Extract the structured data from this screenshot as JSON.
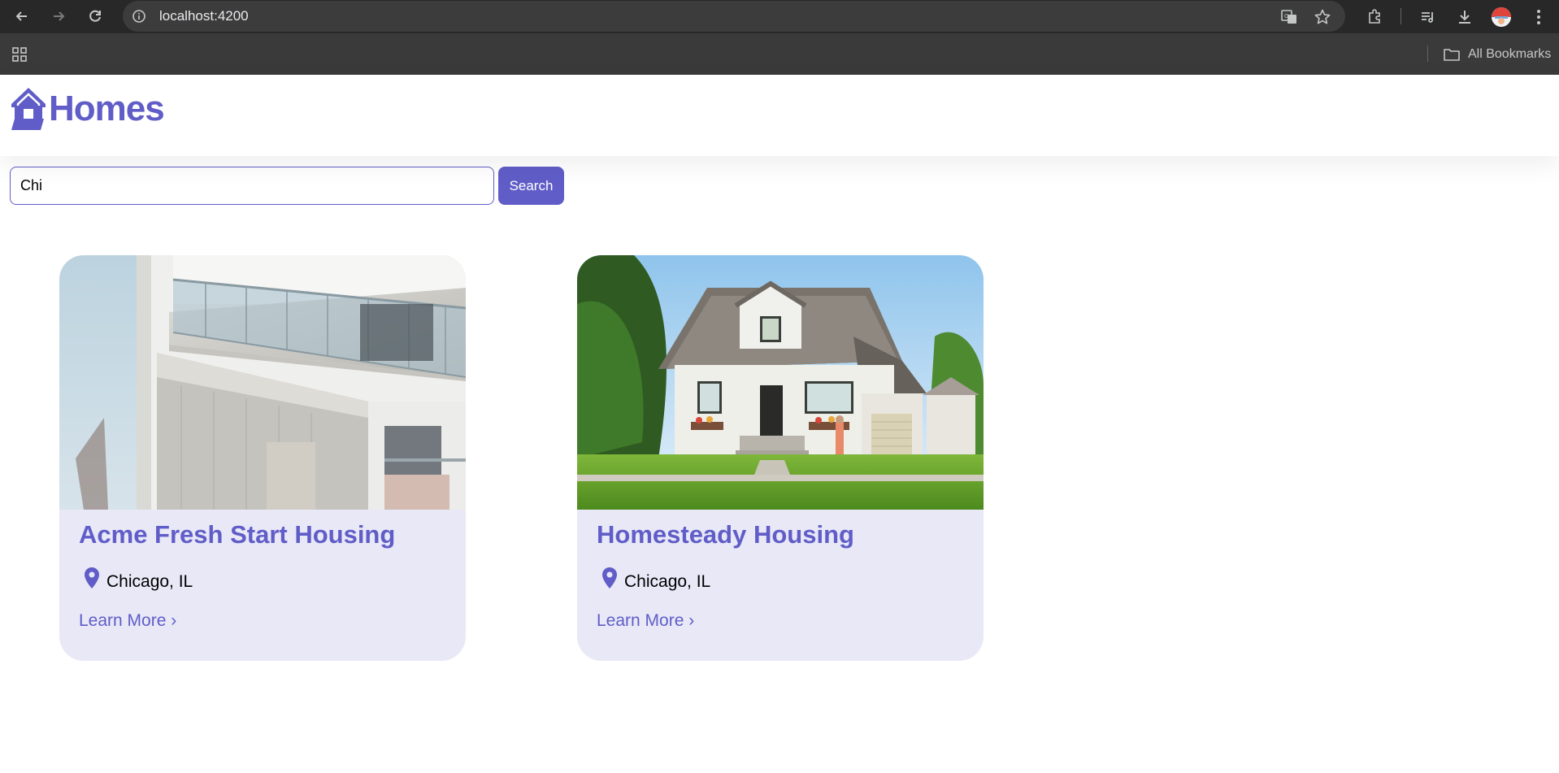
{
  "browser": {
    "url": "localhost:4200",
    "bookmarks_label": "All Bookmarks"
  },
  "header": {
    "logo_text": "Homes"
  },
  "search": {
    "value": "Chi",
    "button_label": "Search"
  },
  "listings": [
    {
      "title": "Acme Fresh Start Housing",
      "location": "Chicago, IL",
      "link_label": "Learn More ›",
      "photo_icon": "modern-apartment-photo"
    },
    {
      "title": "Homesteady Housing",
      "location": "Chicago, IL",
      "link_label": "Learn More ›",
      "photo_icon": "suburban-house-photo"
    }
  ],
  "colors": {
    "brand": "#605dc8",
    "card_bg": "#e8e8f7"
  }
}
